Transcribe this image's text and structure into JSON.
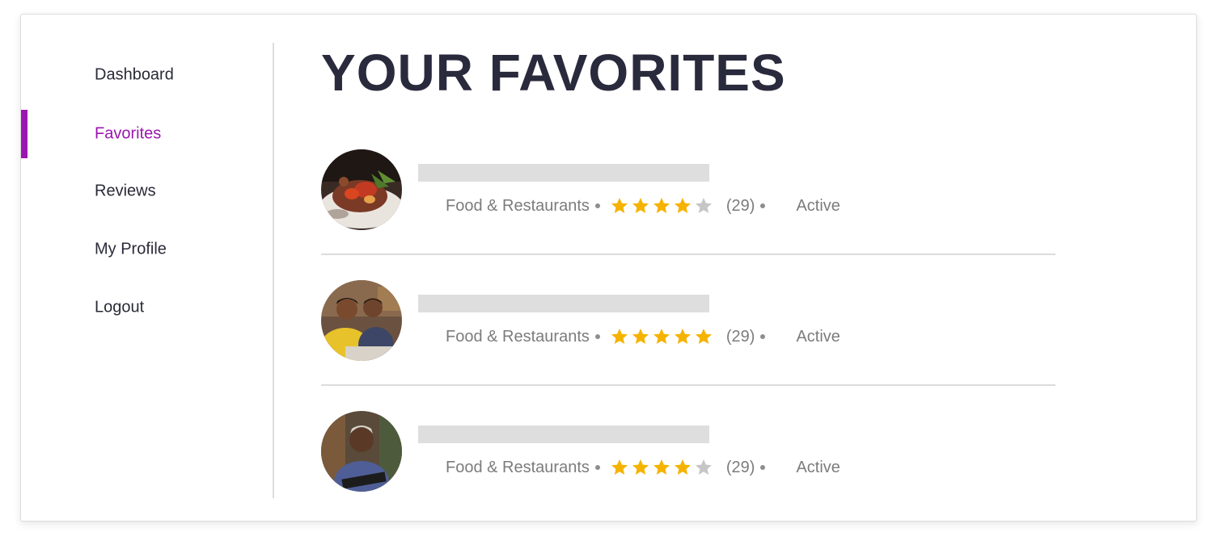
{
  "sidebar": {
    "items": [
      {
        "label": "Dashboard",
        "active": false
      },
      {
        "label": "Favorites",
        "active": true
      },
      {
        "label": "Reviews",
        "active": false
      },
      {
        "label": "My Profile",
        "active": false
      },
      {
        "label": "Logout",
        "active": false
      }
    ]
  },
  "main": {
    "title": "YOUR FAVORITES",
    "favorites": [
      {
        "thumbnail": "food-dish-photo",
        "category": "Food & Restaurants",
        "rating": 4,
        "max_rating": 5,
        "review_count": "(29)",
        "status": "Active"
      },
      {
        "thumbnail": "two-men-photo",
        "category": "Food & Restaurants",
        "rating": 5,
        "max_rating": 5,
        "review_count": "(29)",
        "status": "Active"
      },
      {
        "thumbnail": "man-with-tablet-photo",
        "category": "Food & Restaurants",
        "rating": 4,
        "max_rating": 5,
        "review_count": "(29)",
        "status": "Active"
      }
    ]
  },
  "colors": {
    "accent": "#9b16b0",
    "title": "#2a2a3d",
    "star_on": "#f5b300",
    "star_off": "#c6c6c6",
    "meta_text": "#7c7c7c",
    "placeholder_bar": "#dedede"
  }
}
